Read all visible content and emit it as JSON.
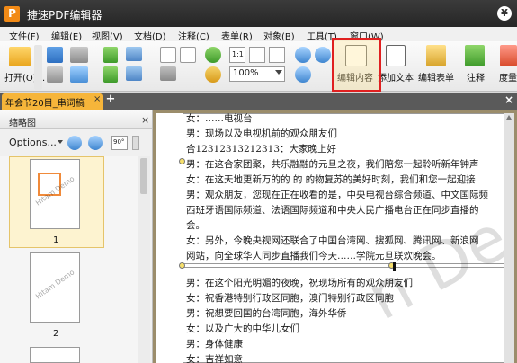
{
  "window": {
    "title": "捷速PDF编辑器",
    "app_icon_letter": "P",
    "help_symbol": "¥"
  },
  "menu": [
    "文件(F)",
    "编辑(E)",
    "视图(V)",
    "文档(D)",
    "注释(C)",
    "表单(R)",
    "对象(B)",
    "工具(T)",
    "窗口(W)"
  ],
  "toolbar": {
    "open_label": "打开(O)...",
    "zoom_value": "100%",
    "edit_content_label": "编辑内容",
    "add_text_label": "添加文本",
    "edit_form_label": "编辑表单",
    "annotate_label": "注释",
    "measure_label": "度量",
    "actual_size_label": "1:1"
  },
  "tabs": {
    "active_tab": "年会节20目_串词稿",
    "close_symbol": "×",
    "new_tab_symbol": "+",
    "pane_close_symbol": "×"
  },
  "thumbnails": {
    "title": "缩略图",
    "close_symbol": "×",
    "options_label": "Options...",
    "rotate_label": "90°",
    "pages": [
      {
        "number": "1",
        "selected": true
      },
      {
        "number": "2",
        "selected": false
      }
    ],
    "watermark": "Hitam Demo"
  },
  "document": {
    "textbox1_lines": [
      "女：……电视台",
      "男：现场以及电视机前的观众朋友们",
      "合12312313212313：大家晚上好",
      "男：在这合家团聚，共乐融融的元旦之夜，我们陪您一起聆听新年钟声",
      "女：在这天地更新万的的 的 的物复苏的美好时刻，我们和您一起迎接",
      "男：观众朋友，您现在正在收看的是，中央电视台综合频道、中文国际频",
      "西班牙语国际频道、法语国际频道和中央人民广播电台正在同步直播的",
      "会。",
      "女：另外，今晚央视网还联合了中国台湾网、搜狐网、腾讯网、新浪网",
      "网站，向全球华人同步直播我们今天……学院元旦联欢晚会。"
    ],
    "textbox2_lines": [
      "男：在这个阳光明媚的夜晚，祝现场所有的观众朋友们",
      "女：祝香港特别行政区同胞，澳门特别行政区同胞",
      "男：祝想要回国的台湾同胞，海外华侨",
      "女：以及广大的中华儿女们",
      "男：身体健康",
      "女：吉祥如意"
    ],
    "watermark": "n De"
  },
  "colors": {
    "accent_tab": "#f6b53a",
    "highlight_border": "#e02020",
    "doc_background": "#9b8d6b"
  }
}
